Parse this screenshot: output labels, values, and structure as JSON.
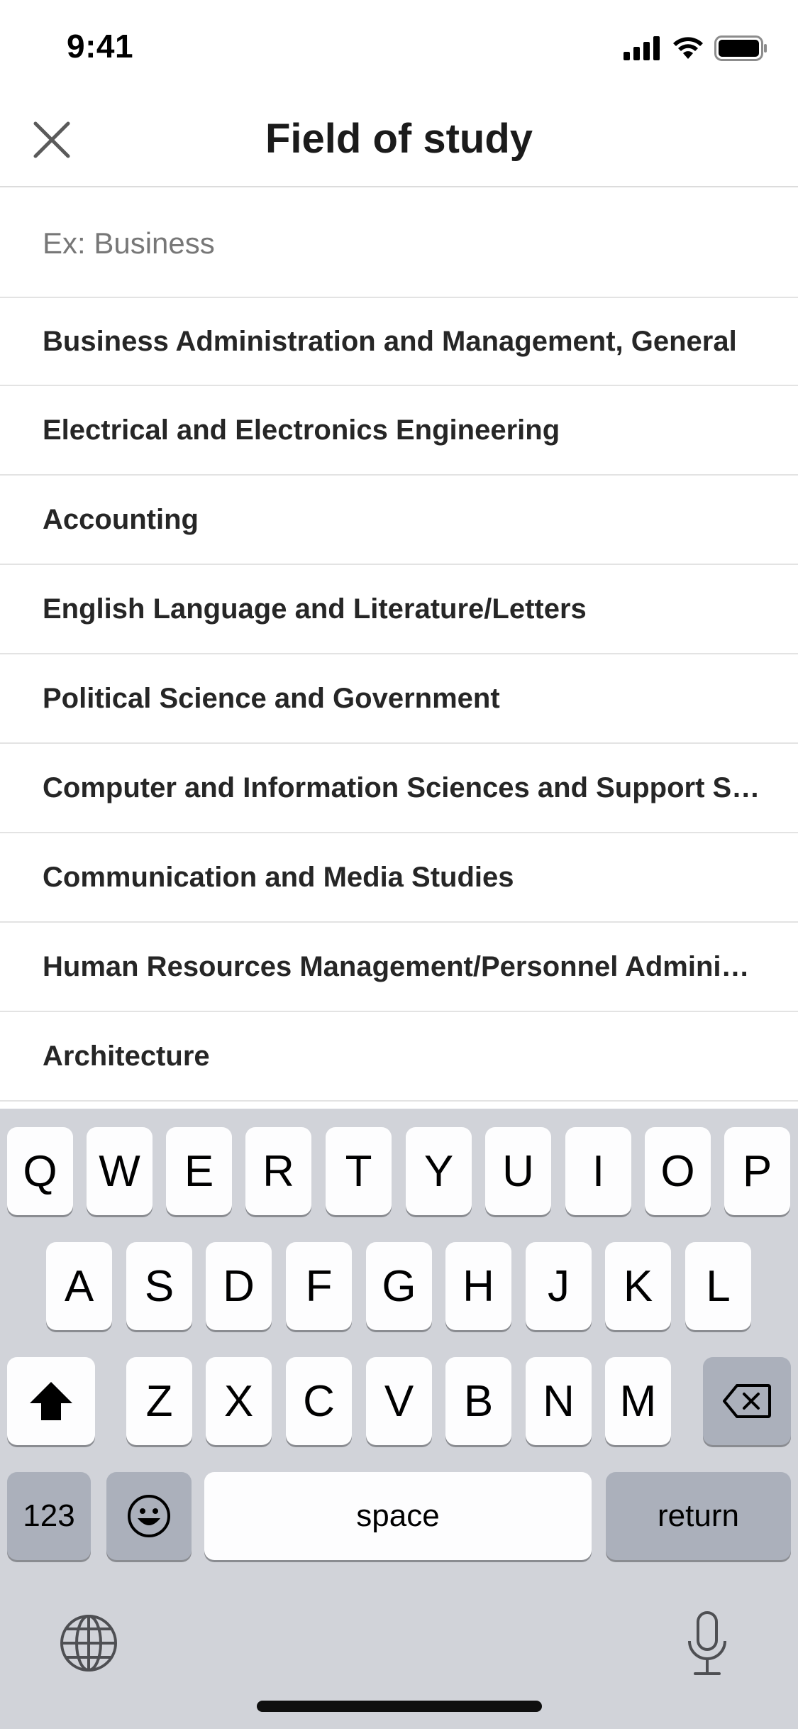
{
  "status": {
    "time": "9:41"
  },
  "header": {
    "title": "Field of study",
    "close_icon": "close-icon"
  },
  "search": {
    "placeholder": "Ex: Business",
    "value": ""
  },
  "results": [
    "Business Administration and Management, General",
    "Electrical and Electronics Engineering",
    "Accounting",
    "English Language and Literature/Letters",
    "Political Science and Government",
    "Computer and Information Sciences and Support Services",
    "Communication and Media Studies",
    "Human Resources Management/Personnel Administration",
    "Architecture"
  ],
  "keyboard": {
    "row1": [
      "Q",
      "W",
      "E",
      "R",
      "T",
      "Y",
      "U",
      "I",
      "O",
      "P"
    ],
    "row2": [
      "A",
      "S",
      "D",
      "F",
      "G",
      "H",
      "J",
      "K",
      "L"
    ],
    "row3": [
      "Z",
      "X",
      "C",
      "V",
      "B",
      "N",
      "M"
    ],
    "numbers_label": "123",
    "space_label": "space",
    "return_label": "return",
    "shift_icon": "shift-icon",
    "delete_icon": "delete-icon",
    "emoji_icon": "emoji-icon",
    "globe_icon": "globe-icon",
    "microphone_icon": "microphone-icon"
  }
}
